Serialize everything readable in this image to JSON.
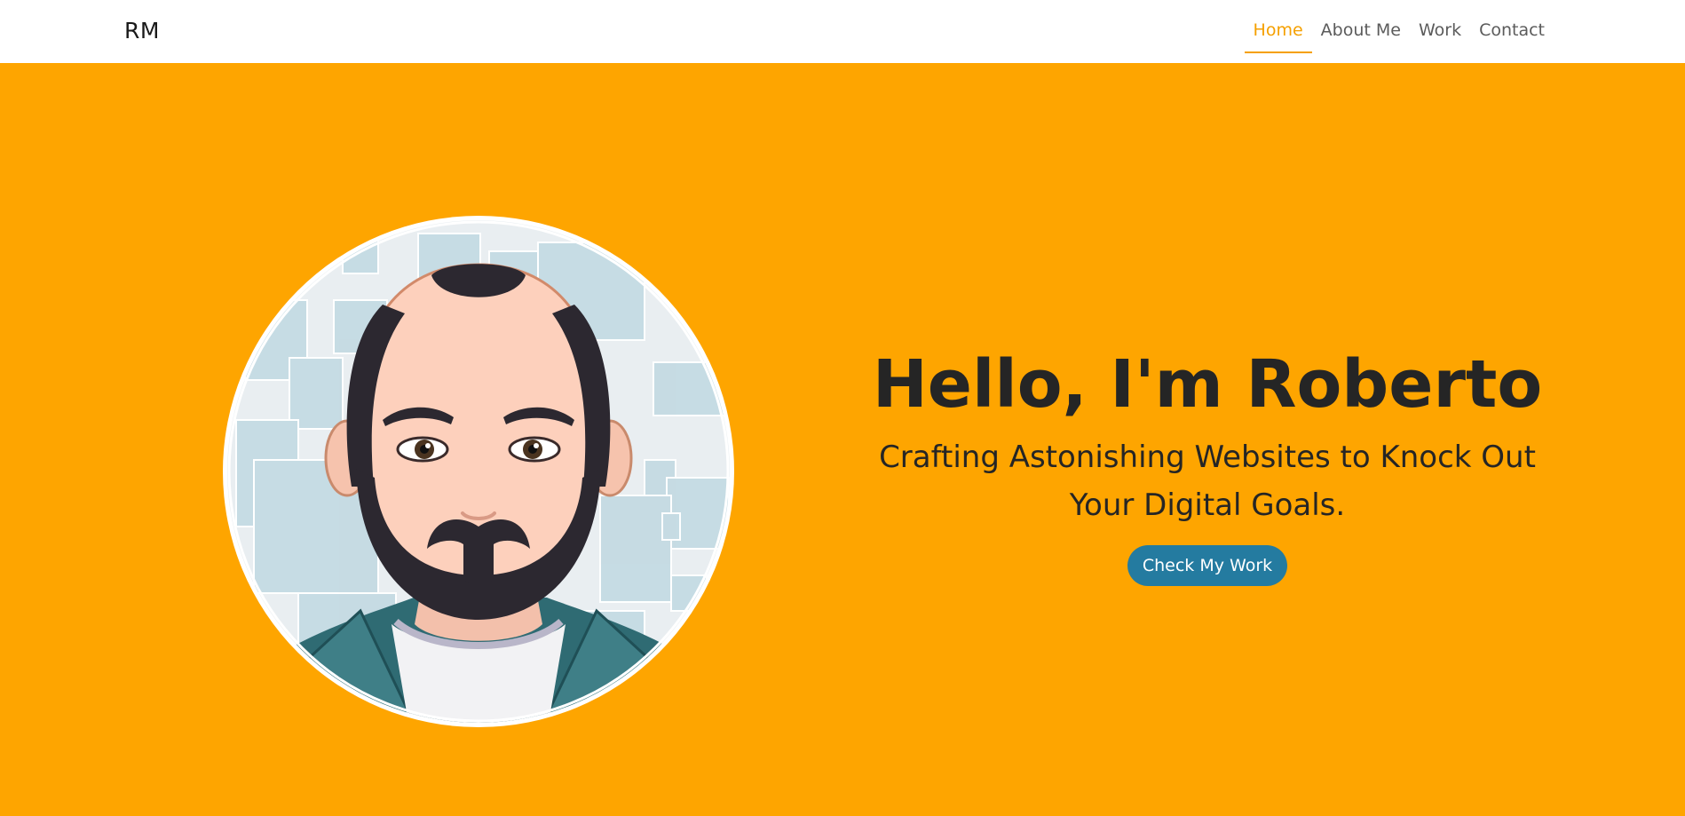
{
  "nav": {
    "brand": "RM",
    "items": [
      {
        "label": "Home",
        "active": true
      },
      {
        "label": "About Me",
        "active": false
      },
      {
        "label": "Work",
        "active": false
      },
      {
        "label": "Contact",
        "active": false
      }
    ]
  },
  "hero": {
    "title": "Hello, I'm Roberto",
    "subtitle": "Crafting Astonishing Websites to Knock Out Your Digital Goals.",
    "cta_label": "Check My Work",
    "avatar_icon": "cartoon-bearded-man-avatar"
  },
  "colors": {
    "accent": "#f5a000",
    "hero_background": "#fea500",
    "button": "#247ba0",
    "text_dark": "#252525",
    "nav_text": "#5b5b5b"
  }
}
